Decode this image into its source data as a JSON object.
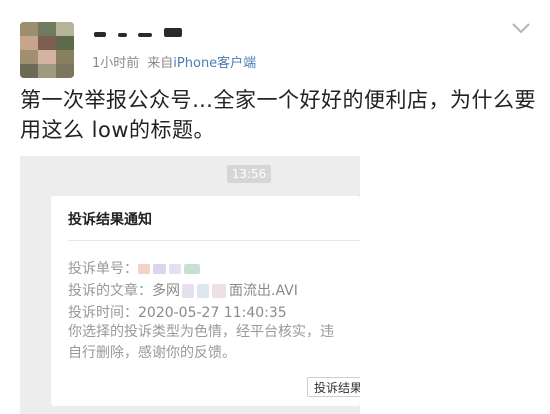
{
  "post": {
    "meta": {
      "time": "1小时前",
      "source_prefix": "来自",
      "source_link": "iPhone客户端"
    },
    "text": "第一次举报公众号…全家一个好好的便利店，为什么要用这么 low的标题。"
  },
  "screenshot": {
    "time": "13:56",
    "card": {
      "title": "投诉结果通知",
      "order_label": "投诉单号：",
      "article_label": "投诉的文章：",
      "article_prefix": "多网",
      "article_suffix": "面流出.AVI",
      "time_label": "投诉时间：",
      "time_value": "2020-05-27 11:40:35",
      "desc_line1": "你选择的投诉类型为色情，经平台核实，违",
      "desc_line2": "自行删除，感谢你的反馈。",
      "button_label": "投诉结果"
    }
  },
  "colors": {
    "link": "#4a7bb5",
    "meta": "#8a8a8a",
    "text": "#222222"
  },
  "icons": {
    "menu": "chevron-down-icon"
  }
}
